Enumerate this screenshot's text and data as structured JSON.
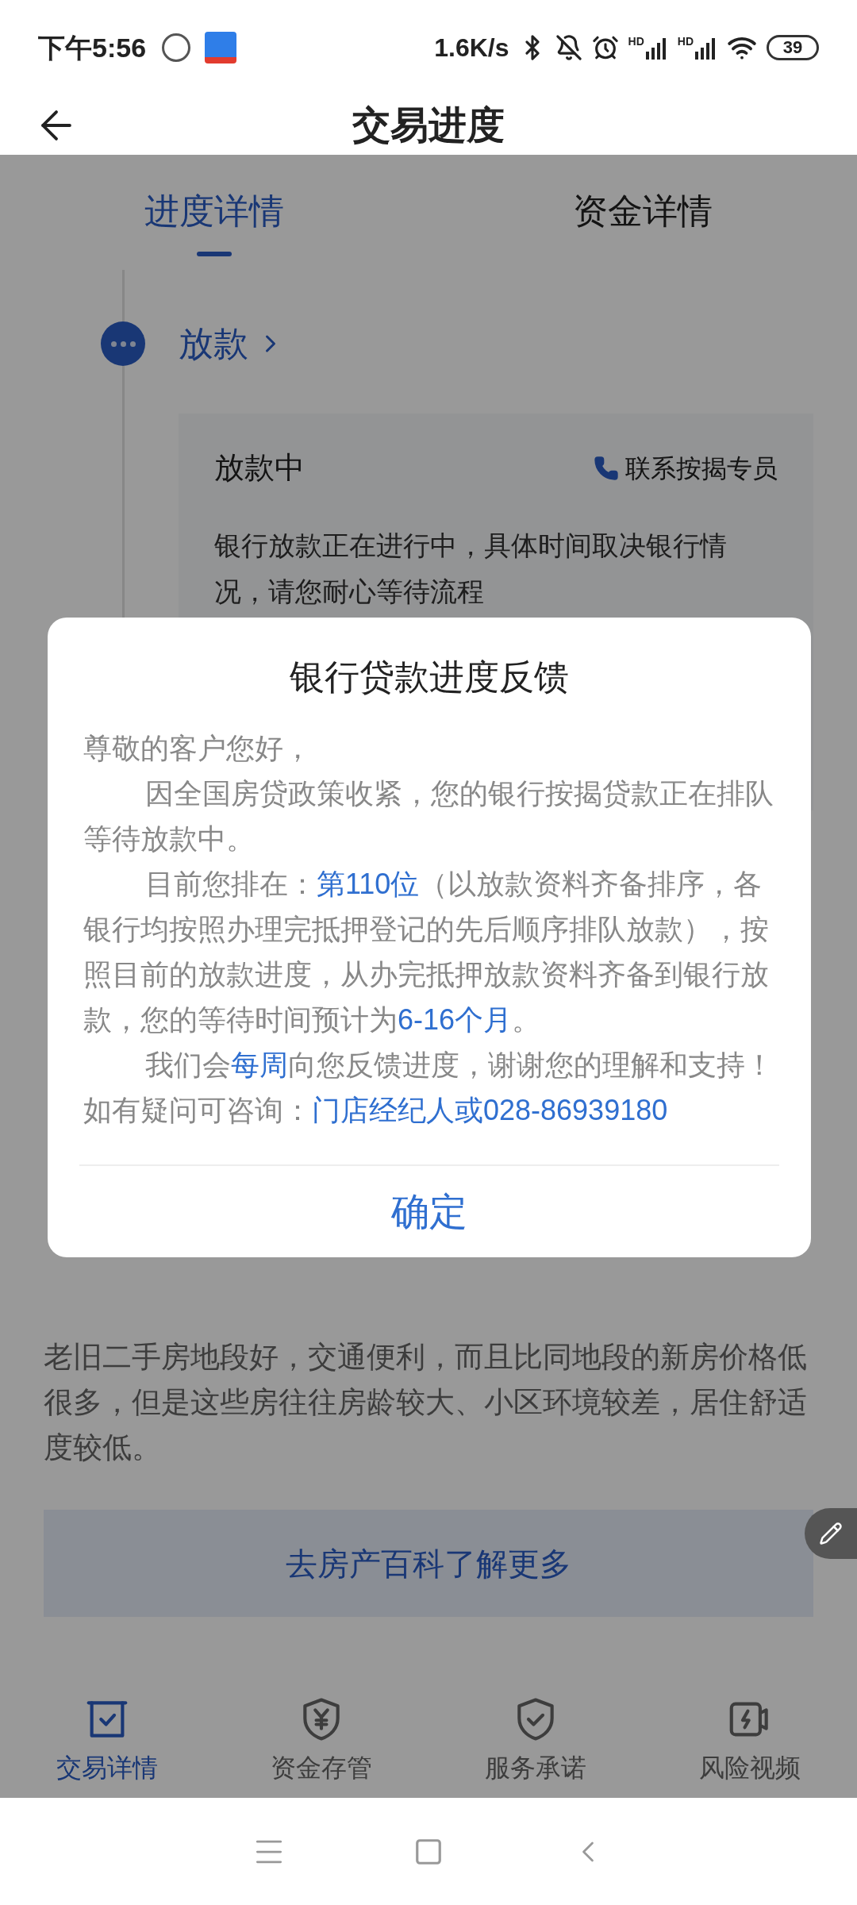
{
  "status_bar": {
    "time": "下午5:56",
    "net_speed": "1.6K/s",
    "signal_labels": [
      "HD",
      "HD"
    ],
    "battery": "39"
  },
  "header": {
    "title": "交易进度"
  },
  "tabs": [
    {
      "label": "进度详情",
      "selected": true
    },
    {
      "label": "资金详情",
      "selected": false
    }
  ],
  "step": {
    "title": "放款"
  },
  "card": {
    "title": "放款中",
    "contact": "联系按揭专员",
    "description": "银行放款正在进行中，具体时间取决银行情况，请您耐心等待流程"
  },
  "article": {
    "text": "老旧二手房地段好，交通便利，而且比同地段的新房价格低很多，但是这些房往往房龄较大、小区环境较差，居住舒适度较低。"
  },
  "more_button": "去房产百科了解更多",
  "bottom_tabs": [
    {
      "label": "交易详情",
      "selected": true
    },
    {
      "label": "资金存管",
      "selected": false
    },
    {
      "label": "服务承诺",
      "selected": false
    },
    {
      "label": "风险视频",
      "selected": false
    }
  ],
  "dialog": {
    "title": "银行贷款进度反馈",
    "greeting": "尊敬的客户您好，",
    "paragraphs": [
      [
        {
          "text": "因全国房贷政策收紧，您的银行按揭贷款正在排队等待放款中。",
          "highlight": false
        }
      ],
      [
        {
          "text": "目前您排在：",
          "highlight": false
        },
        {
          "text": "第110位",
          "highlight": true
        },
        {
          "text": "（以放款资料齐备排序，各银行均按照办理完抵押登记的先后顺序排队放款），按照目前的放款进度，从办完抵押放款资料齐备到银行放款，您的等待时间预计为",
          "highlight": false
        },
        {
          "text": "6-16个月",
          "highlight": true
        },
        {
          "text": "。",
          "highlight": false
        }
      ],
      [
        {
          "text": "我们会",
          "highlight": false
        },
        {
          "text": "每周",
          "highlight": true
        },
        {
          "text": "向您反馈进度，谢谢您的理解和支持！如有疑问可咨询：",
          "highlight": false
        },
        {
          "text": "门店经纪人或028-86939180",
          "highlight": true
        }
      ]
    ],
    "confirm": "确定"
  }
}
